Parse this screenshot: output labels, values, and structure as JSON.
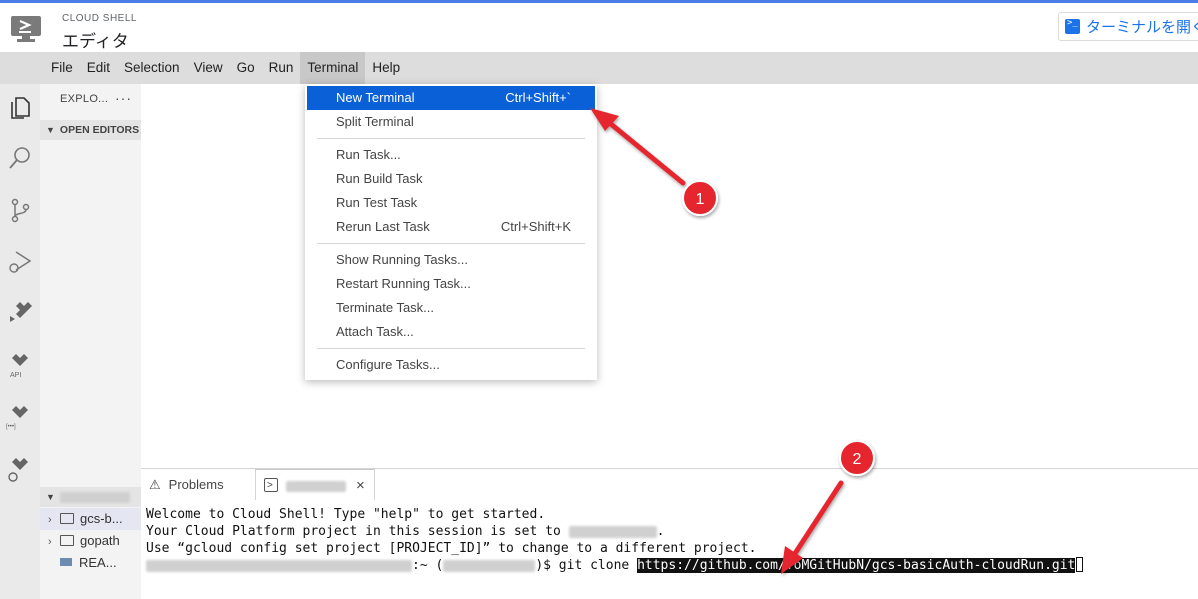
{
  "header": {
    "brand_small": "CLOUD SHELL",
    "brand_title": "エディタ",
    "open_terminal_button": "ターミナルを開く"
  },
  "menubar": {
    "items": [
      "File",
      "Edit",
      "Selection",
      "View",
      "Go",
      "Run",
      "Terminal",
      "Help"
    ],
    "active": "Terminal"
  },
  "activitybar": {
    "icons": [
      "explorer-icon",
      "search-icon",
      "source-control-icon",
      "run-debug-icon",
      "cloud-code-icon",
      "cloud-api-icon",
      "cloud-code-icon",
      "cloud-code-icon"
    ],
    "labels": {
      "api": "API",
      "bracket": "[•••]"
    }
  },
  "explorer": {
    "title": "EXPLO...",
    "more": "···",
    "open_editors": "OPEN EDITORS",
    "files": [
      {
        "name": "gcs-b...",
        "type": "folder"
      },
      {
        "name": "gopath",
        "type": "folder"
      },
      {
        "name": "REA...",
        "type": "file"
      }
    ]
  },
  "terminal_menu": {
    "groups": [
      [
        {
          "label": "New Terminal",
          "shortcut": "Ctrl+Shift+`",
          "highlighted": true
        },
        {
          "label": "Split Terminal",
          "shortcut": ""
        }
      ],
      [
        {
          "label": "Run Task...",
          "shortcut": ""
        },
        {
          "label": "Run Build Task",
          "shortcut": ""
        },
        {
          "label": "Run Test Task",
          "shortcut": ""
        },
        {
          "label": "Rerun Last Task",
          "shortcut": "Ctrl+Shift+K"
        }
      ],
      [
        {
          "label": "Show Running Tasks...",
          "shortcut": ""
        },
        {
          "label": "Restart Running Task...",
          "shortcut": ""
        },
        {
          "label": "Terminate Task...",
          "shortcut": ""
        },
        {
          "label": "Attach Task...",
          "shortcut": ""
        }
      ],
      [
        {
          "label": "Configure Tasks...",
          "shortcut": ""
        }
      ]
    ]
  },
  "panel": {
    "problems_tab": "Problems",
    "terminal_lines": {
      "line1": "Welcome to Cloud Shell! Type \"help\" to get started.",
      "line2_prefix": "Your Cloud Platform project in this session is set to ",
      "line2_suffix": ".",
      "line3": "Use “gcloud config set project [PROJECT_ID]” to change to a different project.",
      "prompt_sep": ":~ (",
      "prompt_end": ")$ ",
      "command": "git clone ",
      "url": "https://github.com/ToMGitHubN/gcs-basicAuth-cloudRun.git"
    }
  },
  "annotations": [
    {
      "number": "1",
      "color": "#e5282e"
    },
    {
      "number": "2",
      "color": "#e5282e"
    }
  ],
  "colors": {
    "menu_highlight": "#0a60d6",
    "accent_blue": "#1a73e8",
    "annotation_red": "#e5282e"
  }
}
